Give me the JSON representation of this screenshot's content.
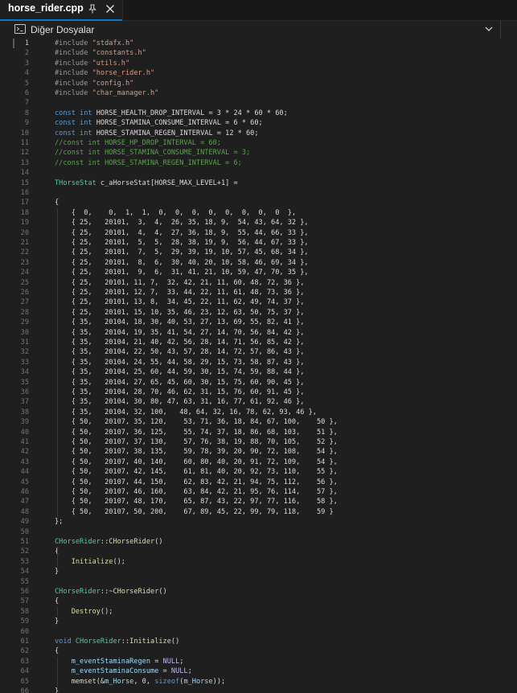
{
  "tab": {
    "title": "horse_rider.cpp"
  },
  "nav": {
    "label": "Diğer Dosyalar"
  },
  "colors": {
    "keyword": "#569cd6",
    "string": "#d69d85",
    "comment": "#57a64a",
    "number": "#b5cea8",
    "type": "#4ec9b0",
    "func": "#dcdcaa",
    "macro": "#beb7ff",
    "preproc": "#9b9b9b",
    "variable": "#9cdcfe",
    "text": "#dcdcdc"
  },
  "current_line": 1,
  "lines": [
    [
      [
        "p",
        "#include "
      ],
      [
        "s",
        "\"stdafx.h\""
      ]
    ],
    [
      [
        "p",
        "#include "
      ],
      [
        "s",
        "\"constants.h\""
      ]
    ],
    [
      [
        "p",
        "#include "
      ],
      [
        "s",
        "\"utils.h\""
      ]
    ],
    [
      [
        "p",
        "#include "
      ],
      [
        "s",
        "\"horse_rider.h\""
      ]
    ],
    [
      [
        "p",
        "#include "
      ],
      [
        "s",
        "\"config.h\""
      ]
    ],
    [
      [
        "p",
        "#include "
      ],
      [
        "s",
        "\"char_manager.h\""
      ]
    ],
    [],
    [
      [
        "k",
        "const int "
      ],
      [
        "t",
        "HORSE_HEALTH_DROP_INTERVAL = 3 * 24 * 60 * 60;"
      ]
    ],
    [
      [
        "k",
        "const int "
      ],
      [
        "t",
        "HORSE_STAMINA_CONSUME_INTERVAL = 6 * 60;"
      ]
    ],
    [
      [
        "k",
        "const int "
      ],
      [
        "t",
        "HORSE_STAMINA_REGEN_INTERVAL = 12 * 60;"
      ]
    ],
    [
      [
        "c",
        "//const int HORSE_HP_DROP_INTERVAL = 60;"
      ]
    ],
    [
      [
        "c",
        "//const int HORSE_STAMINA_CONSUME_INTERVAL = 3;"
      ]
    ],
    [
      [
        "c",
        "//const int HORSE_STAMINA_REGEN_INTERVAL = 6;"
      ]
    ],
    [],
    [
      [
        "y",
        "THorseStat"
      ],
      [
        "t",
        " c_aHorseStat[HORSE_MAX_LEVEL+1] ="
      ]
    ],
    [],
    [
      [
        "t",
        "{"
      ]
    ],
    [
      [
        "t",
        "    {  0,    0,  1,  1,  0,  0,  0,  0,  0,  0,  0,  0  },"
      ]
    ],
    [
      [
        "t",
        "    { 25,   20101,  3,  4,  26, 35, 18, 9,  54, 43, 64, 32 },"
      ]
    ],
    [
      [
        "t",
        "    { 25,   20101,  4,  4,  27, 36, 18, 9,  55, 44, 66, 33 },"
      ]
    ],
    [
      [
        "t",
        "    { 25,   20101,  5,  5,  28, 38, 19, 9,  56, 44, 67, 33 },"
      ]
    ],
    [
      [
        "t",
        "    { 25,   20101,  7,  5,  29, 39, 19, 10, 57, 45, 68, 34 },"
      ]
    ],
    [
      [
        "t",
        "    { 25,   20101,  8,  6,  30, 40, 20, 10, 58, 46, 69, 34 },"
      ]
    ],
    [
      [
        "t",
        "    { 25,   20101,  9,  6,  31, 41, 21, 10, 59, 47, 70, 35 },"
      ]
    ],
    [
      [
        "t",
        "    { 25,   20101, 11, 7,  32, 42, 21, 11, 60, 48, 72, 36 },"
      ]
    ],
    [
      [
        "t",
        "    { 25,   20101, 12, 7,  33, 44, 22, 11, 61, 48, 73, 36 },"
      ]
    ],
    [
      [
        "t",
        "    { 25,   20101, 13, 8,  34, 45, 22, 11, 62, 49, 74, 37 },"
      ]
    ],
    [
      [
        "t",
        "    { 25,   20101, 15, 10, 35, 46, 23, 12, 63, 50, 75, 37 },"
      ]
    ],
    [
      [
        "t",
        "    { 35,   20104, 18, 30, 40, 53, 27, 13, 69, 55, 82, 41 },"
      ]
    ],
    [
      [
        "t",
        "    { 35,   20104, 19, 35, 41, 54, 27, 14, 70, 56, 84, 42 },"
      ]
    ],
    [
      [
        "t",
        "    { 35,   20104, 21, 40, 42, 56, 28, 14, 71, 56, 85, 42 },"
      ]
    ],
    [
      [
        "t",
        "    { 35,   20104, 22, 50, 43, 57, 28, 14, 72, 57, 86, 43 },"
      ]
    ],
    [
      [
        "t",
        "    { 35,   20104, 24, 55, 44, 58, 29, 15, 73, 58, 87, 43 },"
      ]
    ],
    [
      [
        "t",
        "    { 35,   20104, 25, 60, 44, 59, 30, 15, 74, 59, 88, 44 },"
      ]
    ],
    [
      [
        "t",
        "    { 35,   20104, 27, 65, 45, 60, 30, 15, 75, 60, 90, 45 },"
      ]
    ],
    [
      [
        "t",
        "    { 35,   20104, 28, 70, 46, 62, 31, 15, 76, 60, 91, 45 },"
      ]
    ],
    [
      [
        "t",
        "    { 35,   20104, 30, 80, 47, 63, 31, 16, 77, 61, 92, 46 },"
      ]
    ],
    [
      [
        "t",
        "    { 35,   20104, 32, 100,   48, 64, 32, 16, 78, 62, 93, 46 },"
      ]
    ],
    [
      [
        "t",
        "    { 50,   20107, 35, 120,    53, 71, 36, 18, 84, 67, 100,    50 },"
      ]
    ],
    [
      [
        "t",
        "    { 50,   20107, 36, 125,    55, 74, 37, 18, 86, 68, 103,    51 },"
      ]
    ],
    [
      [
        "t",
        "    { 50,   20107, 37, 130,    57, 76, 38, 19, 88, 70, 105,    52 },"
      ]
    ],
    [
      [
        "t",
        "    { 50,   20107, 38, 135,    59, 78, 39, 20, 90, 72, 108,    54 },"
      ]
    ],
    [
      [
        "t",
        "    { 50,   20107, 40, 140,    60, 80, 40, 20, 91, 72, 109,    54 },"
      ]
    ],
    [
      [
        "t",
        "    { 50,   20107, 42, 145,    61, 81, 40, 20, 92, 73, 110,    55 },"
      ]
    ],
    [
      [
        "t",
        "    { 50,   20107, 44, 150,    62, 83, 42, 21, 94, 75, 112,    56 },"
      ]
    ],
    [
      [
        "t",
        "    { 50,   20107, 46, 160,    63, 84, 42, 21, 95, 76, 114,    57 },"
      ]
    ],
    [
      [
        "t",
        "    { 50,   20107, 48, 170,    65, 87, 43, 22, 97, 77, 116,    58 },"
      ]
    ],
    [
      [
        "t",
        "    { 50,   20107, 50, 200,    67, 89, 45, 22, 99, 79, 118,    59 }"
      ]
    ],
    [
      [
        "t",
        "};"
      ]
    ],
    [],
    [
      [
        "y",
        "CHorseRider"
      ],
      [
        "t",
        "::"
      ],
      [
        "f",
        "CHorseRider"
      ],
      [
        "t",
        "()"
      ]
    ],
    [
      [
        "t",
        "{"
      ]
    ],
    [
      [
        "t",
        "    "
      ],
      [
        "f",
        "Initialize"
      ],
      [
        "t",
        "();"
      ]
    ],
    [
      [
        "t",
        "}"
      ]
    ],
    [],
    [
      [
        "y",
        "CHorseRider"
      ],
      [
        "t",
        "::"
      ],
      [
        "f",
        "~CHorseRider"
      ],
      [
        "t",
        "()"
      ]
    ],
    [
      [
        "t",
        "{"
      ]
    ],
    [
      [
        "t",
        "    "
      ],
      [
        "f",
        "Destroy"
      ],
      [
        "t",
        "();"
      ]
    ],
    [
      [
        "t",
        "}"
      ]
    ],
    [],
    [
      [
        "k",
        "void "
      ],
      [
        "y",
        "CHorseRider"
      ],
      [
        "t",
        "::"
      ],
      [
        "f",
        "Initialize"
      ],
      [
        "t",
        "()"
      ]
    ],
    [
      [
        "t",
        "{"
      ]
    ],
    [
      [
        "t",
        "    "
      ],
      [
        "v",
        "m_eventStaminaRegen"
      ],
      [
        "t",
        " = "
      ],
      [
        "m",
        "NULL"
      ],
      [
        "t",
        ";"
      ]
    ],
    [
      [
        "t",
        "    "
      ],
      [
        "v",
        "m_eventStaminaConsume"
      ],
      [
        "t",
        " = "
      ],
      [
        "m",
        "NULL"
      ],
      [
        "t",
        ";"
      ]
    ],
    [
      [
        "t",
        "    "
      ],
      [
        "f",
        "memset"
      ],
      [
        "t",
        "(&"
      ],
      [
        "v",
        "m_Horse"
      ],
      [
        "t",
        ", 0, "
      ],
      [
        "k",
        "sizeof"
      ],
      [
        "t",
        "("
      ],
      [
        "v",
        "m_Horse"
      ],
      [
        "t",
        "));"
      ]
    ],
    [
      [
        "t",
        "}"
      ]
    ],
    []
  ]
}
